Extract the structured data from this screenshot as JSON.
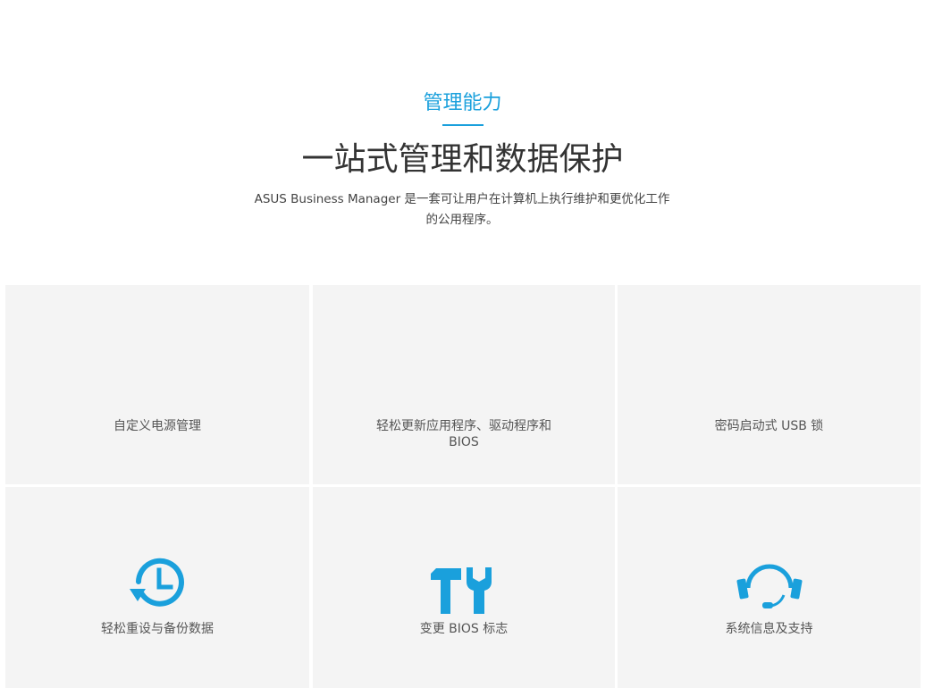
{
  "header": {
    "eyebrow": "管理能力",
    "title": "一站式管理和数据保护",
    "description_line1": "ASUS Business Manager 是一套可让用户在计算机上执行维护和更优化工作",
    "description_line2": "的公用程序。"
  },
  "features": {
    "power": {
      "label": "自定义电源管理"
    },
    "update": {
      "label_line1": "轻松更新应用程序、驱动程序和",
      "label_line2": "BIOS"
    },
    "usb": {
      "label": "密码启动式 USB 锁"
    },
    "backup": {
      "label": "轻松重设与备份数据",
      "icon": "clock-restore-icon"
    },
    "bios_logo": {
      "label": "变更 BIOS 标志",
      "icon": "hammer-wrench-icon"
    },
    "support": {
      "label": "系统信息及支持",
      "icon": "headset-icon"
    }
  },
  "colors": {
    "accent": "#1aa0dc",
    "tile": "#f4f4f4"
  }
}
